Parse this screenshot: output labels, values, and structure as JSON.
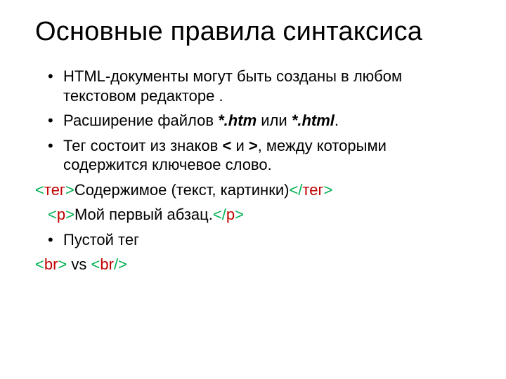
{
  "title": "Основные правила синтаксиса",
  "bullets1": [
    {
      "pre": "HTML-документы могут быть созданы в любом текстовом редакторе .",
      "bold": "",
      "post": ""
    },
    {
      "pre": "Расширение файлов ",
      "bold": "*.htm",
      "mid": " или ",
      "bold2": "*.html",
      "post": "."
    },
    {
      "pre": "Тег состоит из знаков ",
      "bold": "<",
      "mid": " и ",
      "bold2": ">",
      "post": ", между которыми содержится ключевое слово."
    }
  ],
  "example1": {
    "open_lt": "<",
    "open_name": "тег",
    "open_gt": ">",
    "content": "Содержимое  (текст, картинки)",
    "close_lt": "</",
    "close_name": "тег",
    "close_gt": ">"
  },
  "example2": {
    "open_lt": "<",
    "open_name": "p",
    "open_gt": ">",
    "content": "Мой первый абзац.",
    "close_lt": "</",
    "close_name": "p",
    "close_gt": ">"
  },
  "bullets2": [
    {
      "text": "Пустой тег"
    }
  ],
  "example3": {
    "br1_lt": "<",
    "br1_name": "br",
    "br1_gt": ">",
    "vs": " vs ",
    "br2_lt": "<",
    "br2_name": "br",
    "br2_gt": "/>"
  }
}
